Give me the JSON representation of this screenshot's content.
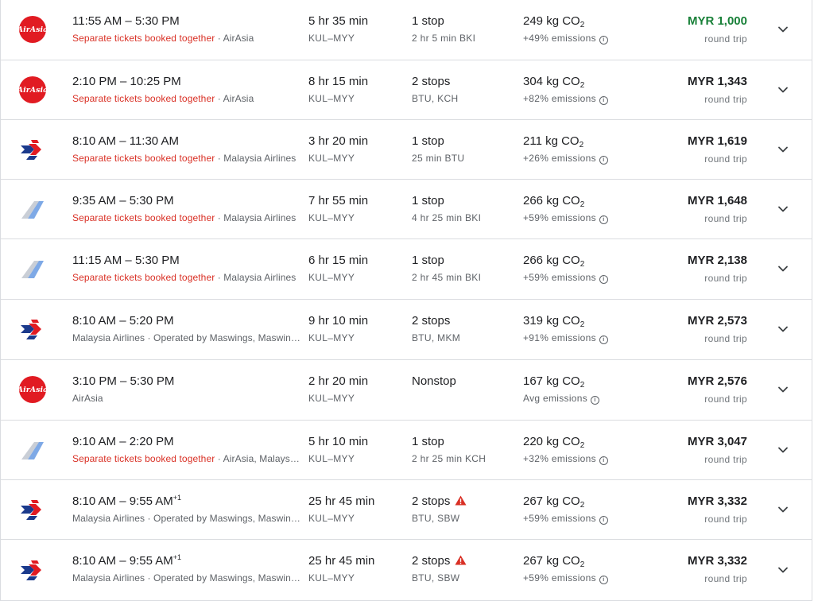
{
  "colors": {
    "separate_tickets": "#d93025",
    "cheapest_price": "#188038",
    "warning": "#d93025",
    "airasia_red": "#e11b22",
    "mas_blue": "#1b3a8c"
  },
  "flights": [
    {
      "airline_logo": "airasia-logo",
      "times": "11:55 AM – 5:30 PM",
      "plus_day": "",
      "separate": "Separate tickets booked together",
      "carrier": "AirAsia",
      "duration": "5 hr 35 min",
      "route": "KUL–MYY",
      "stops": "1 stop",
      "stop_warning": false,
      "stop_detail": "2 hr 5 min BKI",
      "co2": "249 kg CO",
      "co2_sub": "2",
      "emissions": "+49% emissions",
      "price": "MYR 1,000",
      "price_green": true,
      "trip": "round trip"
    },
    {
      "airline_logo": "airasia-logo",
      "times": "2:10 PM – 10:25 PM",
      "plus_day": "",
      "separate": "Separate tickets booked together",
      "carrier": "AirAsia",
      "duration": "8 hr 15 min",
      "route": "KUL–MYY",
      "stops": "2 stops",
      "stop_warning": false,
      "stop_detail": "BTU, KCH",
      "co2": "304 kg CO",
      "co2_sub": "2",
      "emissions": "+82% emissions",
      "price": "MYR 1,343",
      "price_green": false,
      "trip": "round trip"
    },
    {
      "airline_logo": "malaysia-airlines-logo",
      "times": "8:10 AM – 11:30 AM",
      "plus_day": "",
      "separate": "Separate tickets booked together",
      "carrier": "Malaysia Airlines",
      "duration": "3 hr 20 min",
      "route": "KUL–MYY",
      "stops": "1 stop",
      "stop_warning": false,
      "stop_detail": "25 min BTU",
      "co2": "211 kg CO",
      "co2_sub": "2",
      "emissions": "+26% emissions",
      "price": "MYR 1,619",
      "price_green": false,
      "trip": "round trip"
    },
    {
      "airline_logo": "multi-airline-logo",
      "times": "9:35 AM – 5:30 PM",
      "plus_day": "",
      "separate": "Separate tickets booked together",
      "carrier": "Malaysia Airlines",
      "duration": "7 hr 55 min",
      "route": "KUL–MYY",
      "stops": "1 stop",
      "stop_warning": false,
      "stop_detail": "4 hr 25 min BKI",
      "co2": "266 kg CO",
      "co2_sub": "2",
      "emissions": "+59% emissions",
      "price": "MYR 1,648",
      "price_green": false,
      "trip": "round trip"
    },
    {
      "airline_logo": "multi-airline-logo",
      "times": "11:15 AM – 5:30 PM",
      "plus_day": "",
      "separate": "Separate tickets booked together",
      "carrier": "Malaysia Airlines",
      "duration": "6 hr 15 min",
      "route": "KUL–MYY",
      "stops": "1 stop",
      "stop_warning": false,
      "stop_detail": "2 hr 45 min BKI",
      "co2": "266 kg CO",
      "co2_sub": "2",
      "emissions": "+59% emissions",
      "price": "MYR 2,138",
      "price_green": false,
      "trip": "round trip"
    },
    {
      "airline_logo": "malaysia-airlines-logo",
      "times": "8:10 AM – 5:20 PM",
      "plus_day": "",
      "separate": "",
      "carrier": "Malaysia Airlines · Operated by Maswings, Maswings",
      "duration": "9 hr 10 min",
      "route": "KUL–MYY",
      "stops": "2 stops",
      "stop_warning": false,
      "stop_detail": "BTU, MKM",
      "co2": "319 kg CO",
      "co2_sub": "2",
      "emissions": "+91% emissions",
      "price": "MYR 2,573",
      "price_green": false,
      "trip": "round trip"
    },
    {
      "airline_logo": "airasia-logo",
      "times": "3:10 PM – 5:30 PM",
      "plus_day": "",
      "separate": "",
      "carrier": "AirAsia",
      "duration": "2 hr 20 min",
      "route": "KUL–MYY",
      "stops": "Nonstop",
      "stop_warning": false,
      "stop_detail": "",
      "co2": "167 kg CO",
      "co2_sub": "2",
      "emissions": "Avg emissions",
      "price": "MYR 2,576",
      "price_green": false,
      "trip": "round trip"
    },
    {
      "airline_logo": "multi-airline-logo",
      "times": "9:10 AM – 2:20 PM",
      "plus_day": "",
      "separate": "Separate tickets booked together",
      "carrier": "AirAsia, Malaysia Airlines",
      "duration": "5 hr 10 min",
      "route": "KUL–MYY",
      "stops": "1 stop",
      "stop_warning": false,
      "stop_detail": "2 hr 25 min KCH",
      "co2": "220 kg CO",
      "co2_sub": "2",
      "emissions": "+32% emissions",
      "price": "MYR 3,047",
      "price_green": false,
      "trip": "round trip"
    },
    {
      "airline_logo": "malaysia-airlines-logo",
      "times": "8:10 AM – 9:55 AM",
      "plus_day": "+1",
      "separate": "",
      "carrier": "Malaysia Airlines · Operated by Maswings, Maswings",
      "duration": "25 hr 45 min",
      "route": "KUL–MYY",
      "stops": "2 stops",
      "stop_warning": true,
      "stop_detail": "BTU, SBW",
      "co2": "267 kg CO",
      "co2_sub": "2",
      "emissions": "+59% emissions",
      "price": "MYR 3,332",
      "price_green": false,
      "trip": "round trip"
    },
    {
      "airline_logo": "malaysia-airlines-logo",
      "times": "8:10 AM – 9:55 AM",
      "plus_day": "+1",
      "separate": "",
      "carrier": "Malaysia Airlines · Operated by Maswings, Maswings",
      "duration": "25 hr 45 min",
      "route": "KUL–MYY",
      "stops": "2 stops",
      "stop_warning": true,
      "stop_detail": "BTU, SBW",
      "co2": "267 kg CO",
      "co2_sub": "2",
      "emissions": "+59% emissions",
      "price": "MYR 3,332",
      "price_green": false,
      "trip": "round trip"
    }
  ]
}
